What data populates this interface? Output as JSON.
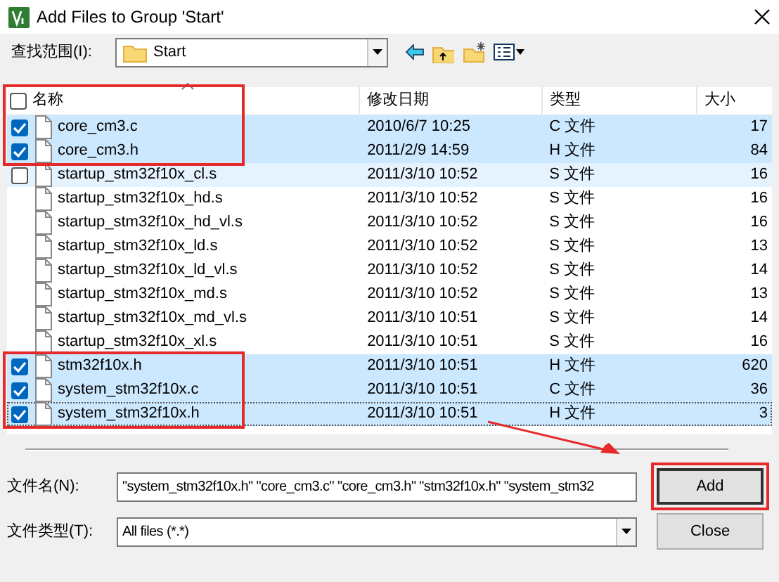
{
  "window": {
    "title": "Add Files to Group 'Start'"
  },
  "look_in": {
    "label": "查找范围(I):",
    "value": "Start"
  },
  "file_list": {
    "columns": [
      "名称",
      "修改日期",
      "类型",
      "大小"
    ],
    "select_all": {
      "checked": false,
      "marked": true
    },
    "rows": [
      {
        "name": "core_cm3.c",
        "date": "2010/6/7 10:25",
        "type": "C 文件",
        "size": "17",
        "checked": true,
        "selected": true,
        "hovered": false,
        "focused": false,
        "marked": true
      },
      {
        "name": "core_cm3.h",
        "date": "2011/2/9 14:59",
        "type": "H 文件",
        "size": "84",
        "checked": true,
        "selected": true,
        "hovered": false,
        "focused": false,
        "marked": true
      },
      {
        "name": "startup_stm32f10x_cl.s",
        "date": "2011/3/10 10:52",
        "type": "S 文件",
        "size": "16",
        "checked": false,
        "selected": false,
        "hovered": true,
        "focused": false,
        "marked": false
      },
      {
        "name": "startup_stm32f10x_hd.s",
        "date": "2011/3/10 10:52",
        "type": "S 文件",
        "size": "16",
        "checked": false,
        "selected": false,
        "hovered": false,
        "focused": false,
        "marked": false
      },
      {
        "name": "startup_stm32f10x_hd_vl.s",
        "date": "2011/3/10 10:52",
        "type": "S 文件",
        "size": "16",
        "checked": false,
        "selected": false,
        "hovered": false,
        "focused": false,
        "marked": false
      },
      {
        "name": "startup_stm32f10x_ld.s",
        "date": "2011/3/10 10:52",
        "type": "S 文件",
        "size": "13",
        "checked": false,
        "selected": false,
        "hovered": false,
        "focused": false,
        "marked": false
      },
      {
        "name": "startup_stm32f10x_ld_vl.s",
        "date": "2011/3/10 10:52",
        "type": "S 文件",
        "size": "14",
        "checked": false,
        "selected": false,
        "hovered": false,
        "focused": false,
        "marked": false
      },
      {
        "name": "startup_stm32f10x_md.s",
        "date": "2011/3/10 10:52",
        "type": "S 文件",
        "size": "13",
        "checked": false,
        "selected": false,
        "hovered": false,
        "focused": false,
        "marked": false
      },
      {
        "name": "startup_stm32f10x_md_vl.s",
        "date": "2011/3/10 10:51",
        "type": "S 文件",
        "size": "14",
        "checked": false,
        "selected": false,
        "hovered": false,
        "focused": false,
        "marked": false
      },
      {
        "name": "startup_stm32f10x_xl.s",
        "date": "2011/3/10 10:51",
        "type": "S 文件",
        "size": "16",
        "checked": false,
        "selected": false,
        "hovered": false,
        "focused": false,
        "marked": false
      },
      {
        "name": "stm32f10x.h",
        "date": "2011/3/10 10:51",
        "type": "H 文件",
        "size": "620",
        "checked": true,
        "selected": true,
        "hovered": false,
        "focused": false,
        "marked": true
      },
      {
        "name": "system_stm32f10x.c",
        "date": "2011/3/10 10:51",
        "type": "C 文件",
        "size": "36",
        "checked": true,
        "selected": true,
        "hovered": false,
        "focused": false,
        "marked": true
      },
      {
        "name": "system_stm32f10x.h",
        "date": "2011/3/10 10:51",
        "type": "H 文件",
        "size": "3",
        "checked": true,
        "selected": true,
        "hovered": false,
        "focused": true,
        "marked": true
      }
    ]
  },
  "file_name": {
    "label": "文件名(N):",
    "value": "\"system_stm32f10x.h\" \"core_cm3.c\" \"core_cm3.h\" \"stm32f10x.h\" \"system_stm32"
  },
  "file_type": {
    "label": "文件类型(T):",
    "value": "All files (*.*)"
  },
  "buttons": [
    {
      "label": "Add",
      "default": true,
      "marked": true
    },
    {
      "label": "Close",
      "default": false,
      "marked": false
    }
  ]
}
